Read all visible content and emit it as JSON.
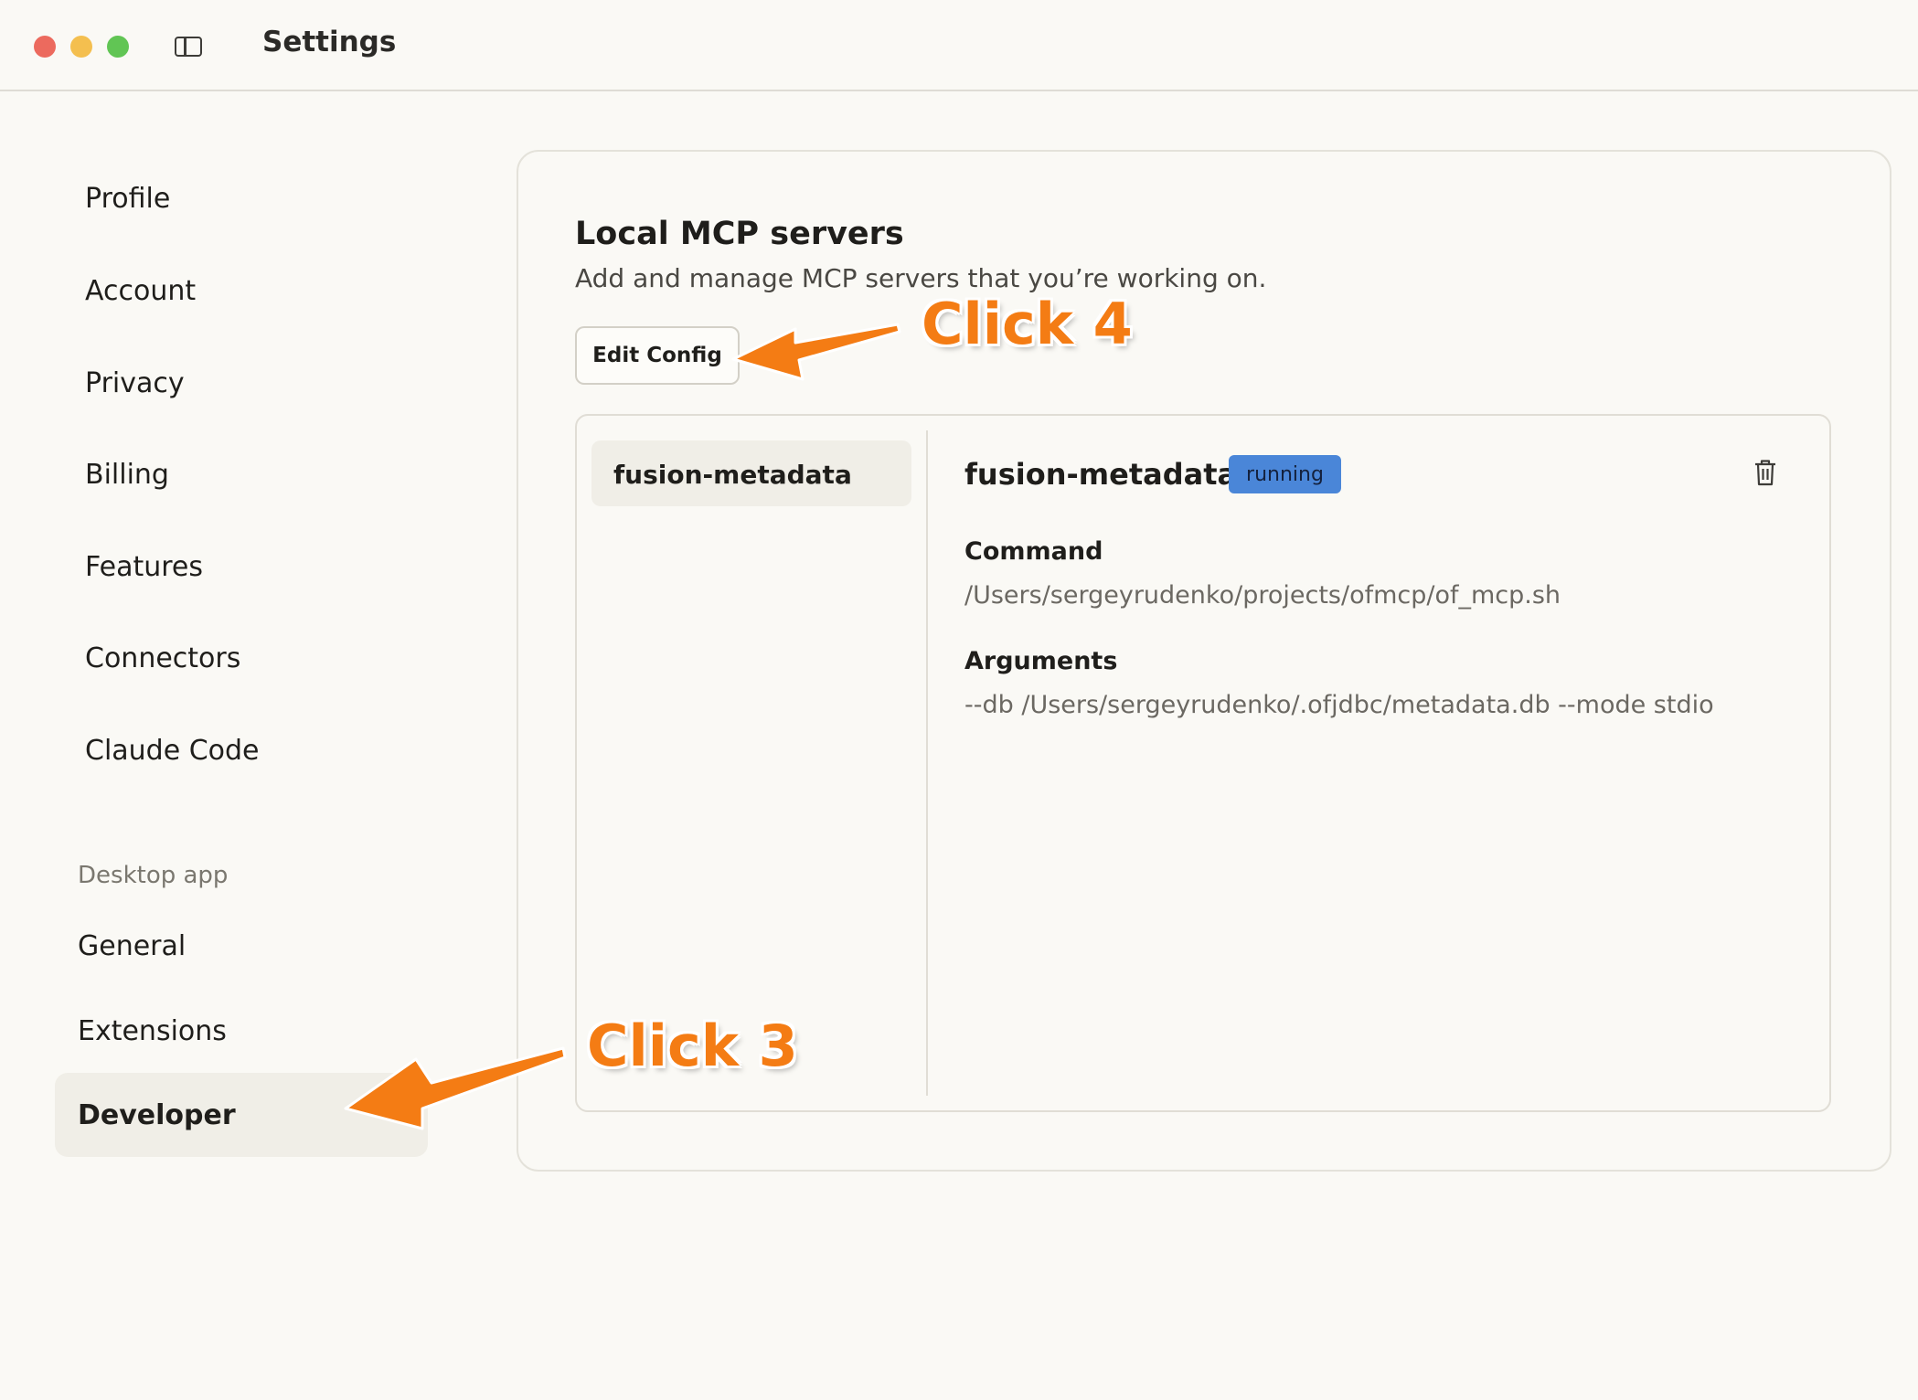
{
  "window": {
    "title": "Settings"
  },
  "sidebar": {
    "items": [
      {
        "label": "Profile"
      },
      {
        "label": "Account"
      },
      {
        "label": "Privacy"
      },
      {
        "label": "Billing"
      },
      {
        "label": "Features"
      },
      {
        "label": "Connectors"
      },
      {
        "label": "Claude Code"
      }
    ],
    "section_label": "Desktop app",
    "app_items": [
      {
        "label": "General"
      },
      {
        "label": "Extensions"
      },
      {
        "label": "Developer",
        "active": true
      }
    ]
  },
  "main": {
    "title": "Local MCP servers",
    "description": "Add and manage MCP servers that you’re working on.",
    "edit_config_label": "Edit Config",
    "servers": [
      {
        "name": "fusion-metadata",
        "status": "running",
        "command_label": "Command",
        "command": "/Users/sergeyrudenko/projects/ofmcp/of_mcp.sh",
        "arguments_label": "Arguments",
        "arguments": "--db /Users/sergeyrudenko/.ofjdbc/metadata.db --mode stdio"
      }
    ]
  },
  "annotations": {
    "click3": "Click 3",
    "click4": "Click 4"
  },
  "colors": {
    "accent_annotation": "#f47c14",
    "status_running": "#4a86d8",
    "background": "#faf9f5"
  },
  "icons": [
    "sidebar-toggle-icon",
    "trash-icon"
  ]
}
